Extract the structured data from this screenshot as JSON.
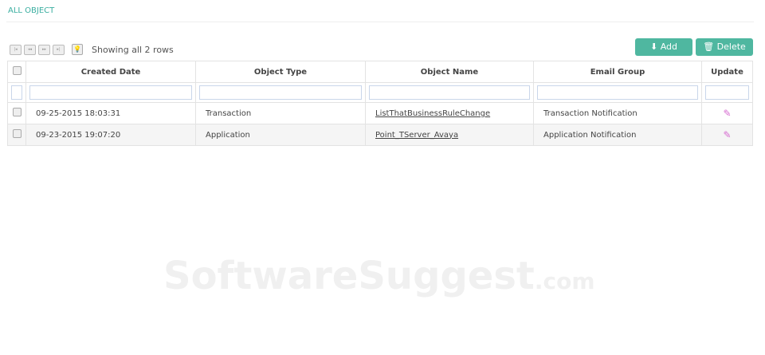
{
  "title": "ALL OBJECT",
  "pager": {
    "showing": "Showing all 2 rows"
  },
  "toolbar": {
    "add": "⬇ Add",
    "delete": "🗑 Delete"
  },
  "columns": [
    "Created Date",
    "Object Type",
    "Object Name",
    "Email Group",
    "Update"
  ],
  "rows": [
    {
      "date": "09-25-2015 18:03:31",
      "type": "Transaction",
      "name": "ListThatBusinessRuleChange",
      "group": "Transaction Notification"
    },
    {
      "date": "09-23-2015 19:07:20",
      "type": "Application",
      "name": "Point_TServer_Avaya",
      "group": "Application Notification"
    }
  ],
  "watermark": {
    "main": "SoftwareSuggest",
    "suffix": ".com"
  }
}
